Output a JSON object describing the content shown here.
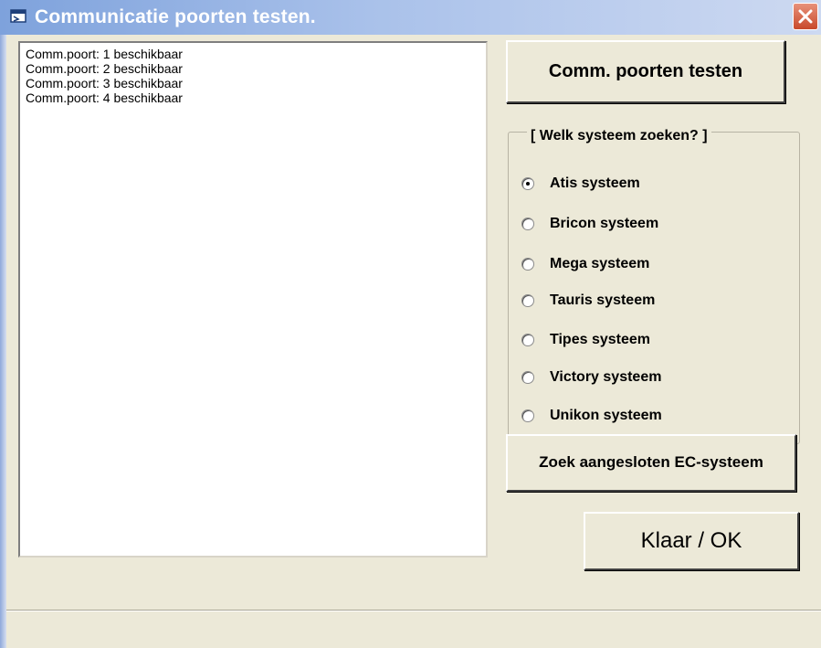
{
  "window": {
    "title": "Communicatie poorten testen.",
    "title_icon": "window-app-icon",
    "close_icon": "close-icon",
    "close_color": "#d0593a"
  },
  "log": {
    "items": [
      "Comm.poort: 1 beschikbaar",
      "Comm.poort: 2 beschikbaar",
      "Comm.poort: 3 beschikbaar",
      "Comm.poort: 4 beschikbaar"
    ]
  },
  "buttons": {
    "test_ports": "Comm. poorten testen",
    "search_system": "Zoek aangesloten EC-systeem",
    "ok": "Klaar / OK"
  },
  "system_group": {
    "legend": "[ Welk systeem zoeken? ]",
    "selected": "Atis systeem",
    "options": [
      "Atis systeem",
      "Bricon systeem",
      "Mega systeem",
      "Tauris systeem",
      "Tipes systeem",
      "Victory systeem",
      "Unikon systeem"
    ]
  },
  "colors": {
    "face": "#ece9d8",
    "titlebar": "#7ea2dc"
  }
}
